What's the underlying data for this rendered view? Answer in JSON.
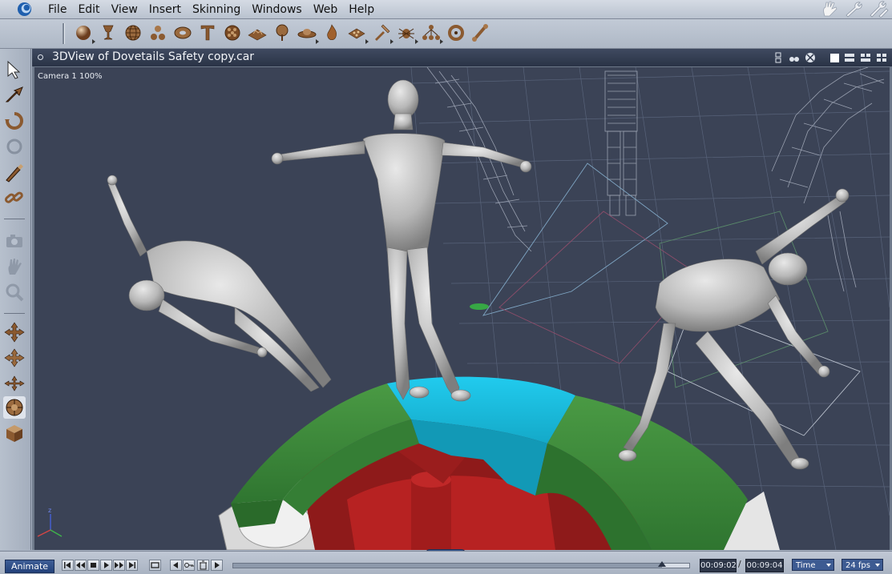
{
  "menu": {
    "items": [
      "File",
      "Edit",
      "View",
      "Insert",
      "Skinning",
      "Windows",
      "Web",
      "Help"
    ]
  },
  "toolbar": {
    "icons": [
      "sphere-icon",
      "goblet-icon",
      "globe-icon",
      "bones-icon",
      "torus-icon",
      "text-icon",
      "gear-ball-icon",
      "terrain-icon",
      "tree-icon",
      "ufo-icon",
      "fire-icon",
      "particles-icon",
      "hammer-icon",
      "insect-icon",
      "hierarchy-icon",
      "ring-icon",
      "bone-icon"
    ]
  },
  "top_right_tools": [
    "hand-pose-icon",
    "wrench-icon",
    "edit-wrench-icon"
  ],
  "left_tools": [
    "select-arrow-icon",
    "transform-arrow-icon",
    "rotate-icon",
    "scale-icon",
    "paint-brush-icon",
    "chain-icon",
    "camera-icon",
    "hand-pan-icon",
    "zoom-icon",
    "move-xy-icon",
    "move-xz-icon",
    "move-yz-icon",
    "trackball-icon",
    "box-bevel-icon"
  ],
  "view": {
    "title": "3DView of Dovetails Safety copy.car",
    "camera_label": "Camera 1 100%"
  },
  "bottom": {
    "animate_label": "Animate",
    "time_current": "00:09:02",
    "time_separator": "/",
    "time_end": "00:09:04",
    "time_mode": "Time",
    "fps": "24 fps",
    "timeline_progress": 0.94
  },
  "colors": {
    "viewport_bg": "#3b4356",
    "ring_green": "#3e8a3e",
    "block_cyan": "#18b8d8",
    "hub_red": "#a01e1e",
    "figure_gray": "#c9c9c9"
  }
}
